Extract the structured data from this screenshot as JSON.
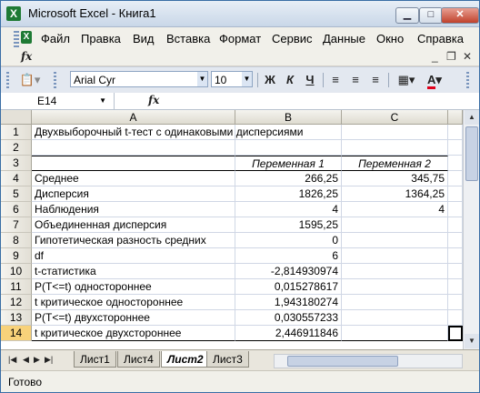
{
  "window": {
    "title": "Microsoft Excel - Книга1",
    "app_icon": "X"
  },
  "menu": {
    "items": [
      "Файл",
      "Правка",
      "Вид",
      "Вставка",
      "Формат",
      "Сервис",
      "Данные",
      "Окно",
      "Справка"
    ]
  },
  "toolbar": {
    "font_name": "Arial Cyr",
    "font_size": "10",
    "bold": "Ж",
    "italic": "К",
    "underline": "Ч",
    "font_color_label": "A",
    "font_color": "#e0001b"
  },
  "formula_bar": {
    "cell_ref": "E14",
    "fx": "fx",
    "content": ""
  },
  "columns": [
    "A",
    "B",
    "C"
  ],
  "rows": [
    {
      "n": "1",
      "a": "Двухвыборочный t-тест с одинаковыми дисперсиями",
      "b": "",
      "c": ""
    },
    {
      "n": "2",
      "a": "",
      "b": "",
      "c": ""
    },
    {
      "n": "3",
      "a": "",
      "b": "Переменная 1",
      "c": "Переменная 2"
    },
    {
      "n": "4",
      "a": "Среднее",
      "b": "266,25",
      "c": "345,75"
    },
    {
      "n": "5",
      "a": "Дисперсия",
      "b": "1826,25",
      "c": "1364,25"
    },
    {
      "n": "6",
      "a": "Наблюдения",
      "b": "4",
      "c": "4"
    },
    {
      "n": "7",
      "a": "Объединенная дисперсия",
      "b": "1595,25",
      "c": ""
    },
    {
      "n": "8",
      "a": "Гипотетическая разность средних",
      "b": "0",
      "c": ""
    },
    {
      "n": "9",
      "a": "df",
      "b": "6",
      "c": ""
    },
    {
      "n": "10",
      "a": "t-статистика",
      "b": "-2,814930974",
      "c": ""
    },
    {
      "n": "11",
      "a": "P(T<=t) одностороннее",
      "b": "0,015278617",
      "c": ""
    },
    {
      "n": "12",
      "a": "t критическое одностороннее",
      "b": "1,943180274",
      "c": ""
    },
    {
      "n": "13",
      "a": "P(T<=t) двухстороннее",
      "b": "0,030557233",
      "c": ""
    },
    {
      "n": "14",
      "a": "t критическое двухстороннее",
      "b": "2,446911846",
      "c": ""
    }
  ],
  "sheets": [
    "Лист1",
    "Лист4",
    "Лист2",
    "Лист3"
  ],
  "active_sheet": "Лист2",
  "status": {
    "text": "Готово"
  },
  "colors": {
    "title_bar": "#c9d7e8",
    "selected_row_header": "#f8d27a",
    "close_button": "#c0412b"
  }
}
